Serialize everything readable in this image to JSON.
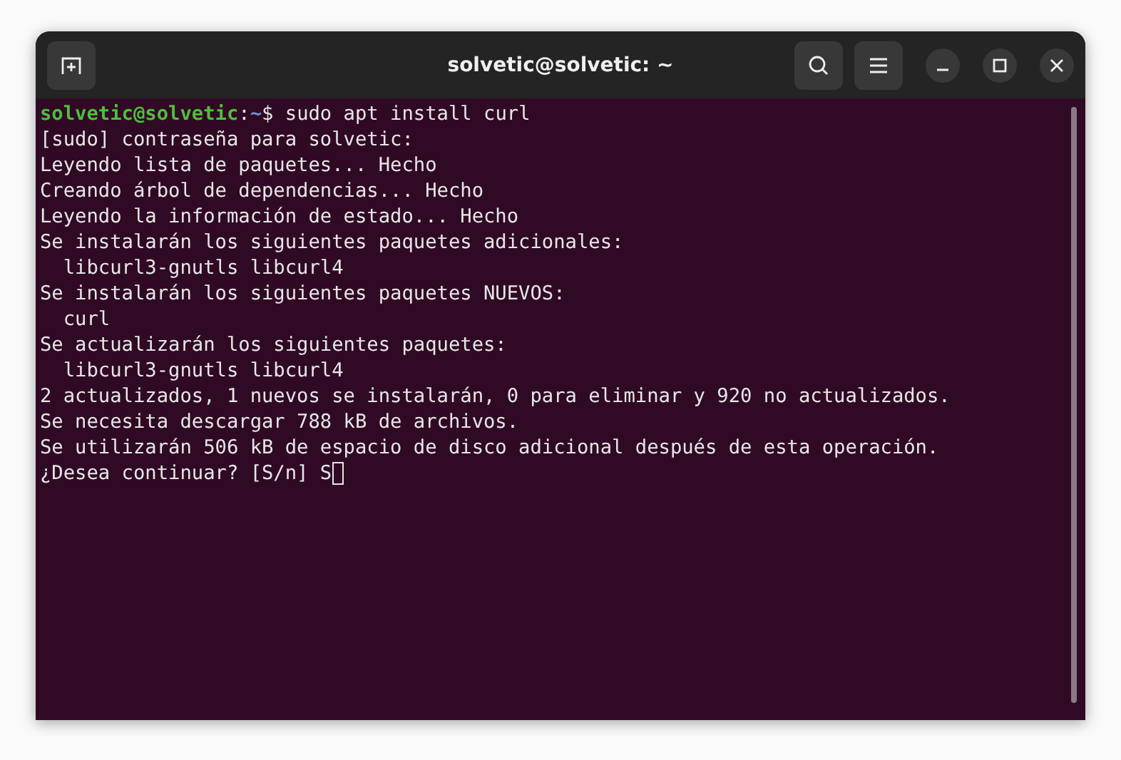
{
  "window": {
    "title": "solvetic@solvetic: ~"
  },
  "terminal": {
    "lines": [
      {
        "kind": "prompt",
        "user": "solvetic@solvetic",
        "separator": ":",
        "path": "~",
        "command": "$ sudo apt install curl"
      },
      {
        "kind": "output",
        "text": "[sudo] contraseña para solvetic:"
      },
      {
        "kind": "output",
        "text": "Leyendo lista de paquetes... Hecho"
      },
      {
        "kind": "output",
        "text": "Creando árbol de dependencias... Hecho"
      },
      {
        "kind": "output",
        "text": "Leyendo la información de estado... Hecho"
      },
      {
        "kind": "output",
        "text": "Se instalarán los siguientes paquetes adicionales:"
      },
      {
        "kind": "output",
        "text": "  libcurl3-gnutls libcurl4"
      },
      {
        "kind": "output",
        "text": "Se instalarán los siguientes paquetes NUEVOS:"
      },
      {
        "kind": "output",
        "text": "  curl"
      },
      {
        "kind": "output",
        "text": "Se actualizarán los siguientes paquetes:"
      },
      {
        "kind": "output",
        "text": "  libcurl3-gnutls libcurl4"
      },
      {
        "kind": "output",
        "text": "2 actualizados, 1 nuevos se instalarán, 0 para eliminar y 920 no actualizados."
      },
      {
        "kind": "output",
        "text": "Se necesita descargar 788 kB de archivos."
      },
      {
        "kind": "output",
        "text": "Se utilizarán 506 kB de espacio de disco adicional después de esta operación."
      },
      {
        "kind": "input",
        "text": "¿Desea continuar? [S/n] S"
      }
    ]
  }
}
